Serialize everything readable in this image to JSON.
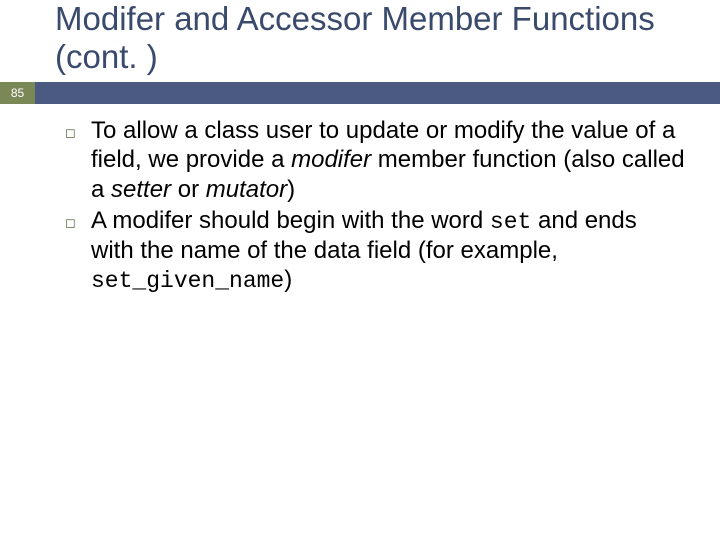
{
  "slide": {
    "title": "Modifer and Accessor Member Functions (cont. )",
    "page_number": "85",
    "bullets": [
      {
        "pre1": "To allow a class user to update or modify the value of a field, we provide a ",
        "em1": "modifer",
        "mid1": " member function (also called a ",
        "em2": "setter",
        "mid2": " or ",
        "em3": "mutator",
        "post1": ")"
      },
      {
        "pre1": "A modifer should begin with the word ",
        "code1": "set",
        "mid1": " and ends with the name of the data field (for example, ",
        "code2": "set_given_name",
        "post1": ")"
      }
    ]
  }
}
